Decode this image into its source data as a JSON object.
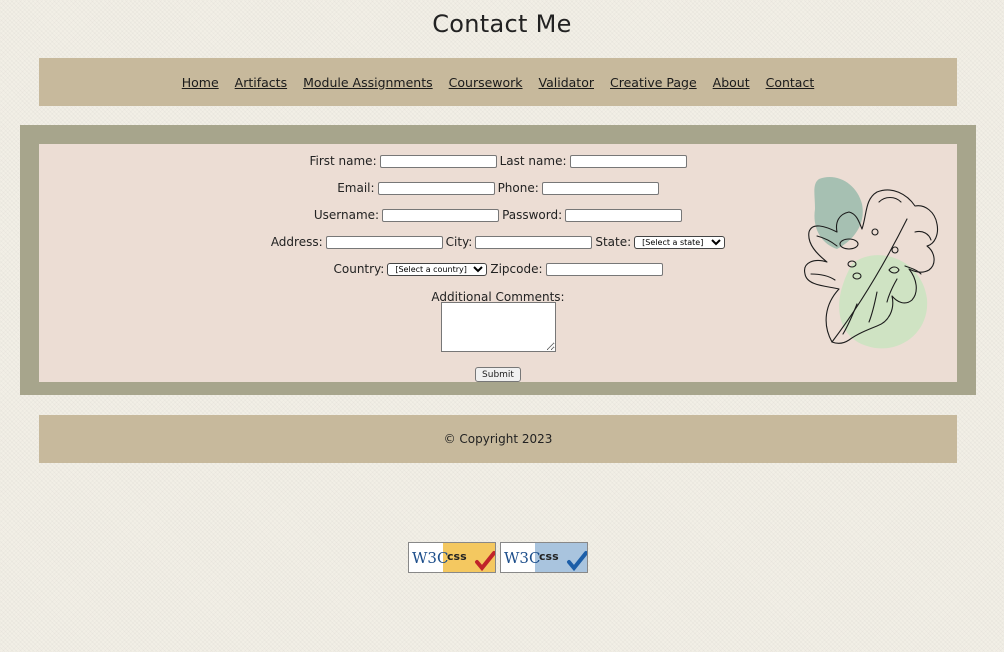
{
  "page": {
    "title": "Contact Me"
  },
  "nav": {
    "items": [
      {
        "label": "Home"
      },
      {
        "label": "Artifacts"
      },
      {
        "label": "Module Assignments"
      },
      {
        "label": "Coursework"
      },
      {
        "label": "Validator"
      },
      {
        "label": "Creative Page"
      },
      {
        "label": "About"
      },
      {
        "label": "Contact"
      }
    ]
  },
  "form": {
    "first_name_label": "First name:",
    "last_name_label": "Last name:",
    "email_label": "Email:",
    "phone_label": "Phone:",
    "username_label": "Username:",
    "password_label": "Password:",
    "address_label": "Address:",
    "city_label": "City:",
    "state_label": "State:",
    "state_selected": "[Select a state]",
    "country_label": "Country:",
    "country_selected": "[Select a country]",
    "zipcode_label": "Zipcode:",
    "comments_label": "Additional Comments:",
    "submit_label": "Submit"
  },
  "footer": {
    "copyright": "© Copyright 2023"
  },
  "badges": [
    {
      "left": "W3C",
      "right": "css",
      "variant": "gold",
      "icon": "red-checkmark-icon"
    },
    {
      "left": "W3C",
      "right": "css",
      "variant": "blue",
      "icon": "blue-checkmark-icon"
    }
  ],
  "colors": {
    "background": "#f2efe6",
    "nav_bg": "#c7b99c",
    "form_border": "#a7a58c",
    "form_bg": "#ecddd4",
    "leaf_blob_teal": "#9fbcae",
    "leaf_blob_green": "#cfe3c3"
  }
}
